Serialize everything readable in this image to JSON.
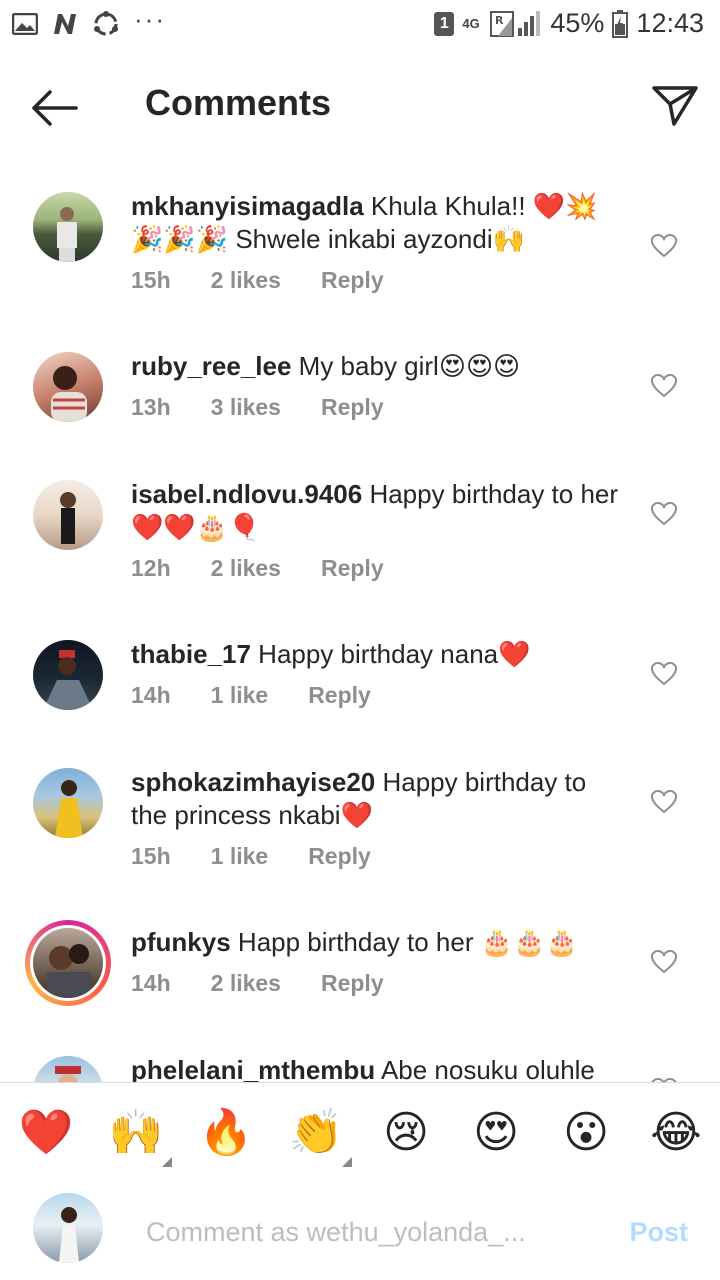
{
  "status_bar": {
    "left_icons": [
      "image-icon",
      "n-app-icon",
      "sync-icon"
    ],
    "dots": "···",
    "sim": "1",
    "network": "4G",
    "battery": "45%",
    "time": "12:43"
  },
  "header": {
    "title": "Comments"
  },
  "comments": [
    {
      "username": "mkhanyisimagadla",
      "text": " Khula Khula!! ❤️💥🎉🎉🎉 Shwele inkabi ayzondi🙌",
      "time": "15h",
      "likes": "2 likes",
      "reply": "Reply"
    },
    {
      "username": "ruby_ree_lee",
      "text": " My baby girl😍😍😍",
      "time": "13h",
      "likes": "3 likes",
      "reply": "Reply"
    },
    {
      "username": "isabel.ndlovu.9406",
      "text": " Happy birthday to her❤️❤️🎂🎈",
      "time": "12h",
      "likes": "2 likes",
      "reply": "Reply"
    },
    {
      "username": "thabie_17",
      "text": " Happy birthday nana❤️",
      "time": "14h",
      "likes": "1 like",
      "reply": "Reply"
    },
    {
      "username": "sphokazimhayise20",
      "text": " Happy birthday to the princess nkabi❤️",
      "time": "15h",
      "likes": "1 like",
      "reply": "Reply"
    },
    {
      "username": "pfunkys",
      "text": " Happ birthday to her 🎂🎂🎂",
      "time": "14h",
      "likes": "2 likes",
      "reply": "Reply"
    },
    {
      "username": "phelelani_mthembu",
      "text": " Abe nosuku oluhle",
      "time": "",
      "likes": "",
      "reply": ""
    }
  ],
  "emoji_bar": {
    "emojis": [
      "❤️",
      "🙌",
      "🔥",
      "👏",
      "😢",
      "😍",
      "😮",
      "😂"
    ]
  },
  "composer": {
    "placeholder": "Comment as wethu_yolanda_...",
    "post_label": "Post"
  },
  "colors": {
    "text": "#262626",
    "meta": "#8e8e8e",
    "post_disabled": "#b3dbff",
    "divider": "#dbdbdb"
  }
}
